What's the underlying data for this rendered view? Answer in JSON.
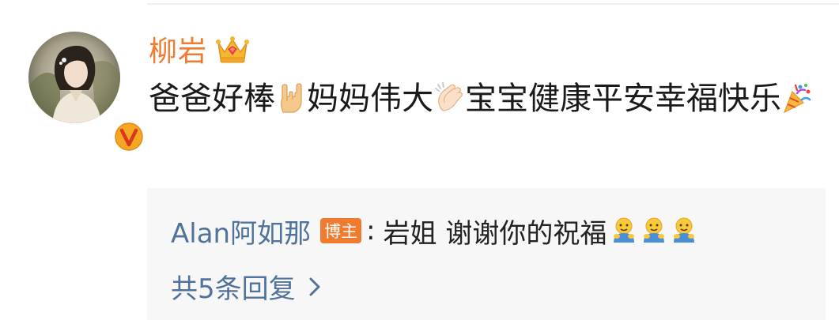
{
  "comment": {
    "username": "柳岩",
    "text_parts": [
      "爸爸好棒",
      "妈妈伟大",
      "宝宝健康平安幸福快乐"
    ],
    "icons": {
      "badge": "verified-v-icon",
      "crown": "crown-icon",
      "emoji_1": "rock-on-hand-emoji",
      "emoji_2": "clapping-hands-emoji",
      "emoji_3": "party-popper-emoji"
    }
  },
  "reply": {
    "author": "Alan阿如那",
    "badge_label": "博主",
    "colon": ":",
    "text": "岩姐 谢谢你的祝福",
    "emoji": "hug-emoji",
    "emoji_count": 3,
    "more_label": "共5条回复"
  },
  "colors": {
    "username": "#f07a2e",
    "link": "#51739b",
    "badge_bg": "#f07a2e",
    "reply_bg": "#f7f7f7"
  }
}
